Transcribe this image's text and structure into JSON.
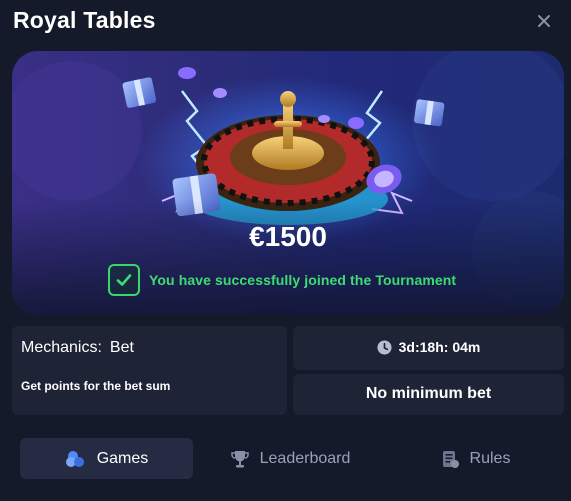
{
  "header": {
    "title": "Royal Tables",
    "close_icon": "close-icon"
  },
  "hero": {
    "prize": "€1500",
    "joined_message": "You have successfully joined the Tournament",
    "check_icon": "check-icon",
    "image_subject": "roulette-wheel-illustration"
  },
  "mechanics": {
    "label": "Mechanics:",
    "value": "Bet",
    "description": "Get points for the bet sum"
  },
  "timer": {
    "icon": "clock-icon",
    "days": "3d",
    "hours": "18h",
    "minutes": "04m"
  },
  "min_bet": "No minimum bet",
  "tabs": [
    {
      "label": "Games",
      "icon": "games-icon",
      "active": true
    },
    {
      "label": "Leaderboard",
      "icon": "trophy-icon",
      "active": false
    },
    {
      "label": "Rules",
      "icon": "rules-icon",
      "active": false
    }
  ],
  "colors": {
    "background": "#151a2b",
    "card": "#1e2336",
    "success": "#3ddc72",
    "active_tab": "#252b42",
    "muted_text": "#9aa0b8"
  }
}
